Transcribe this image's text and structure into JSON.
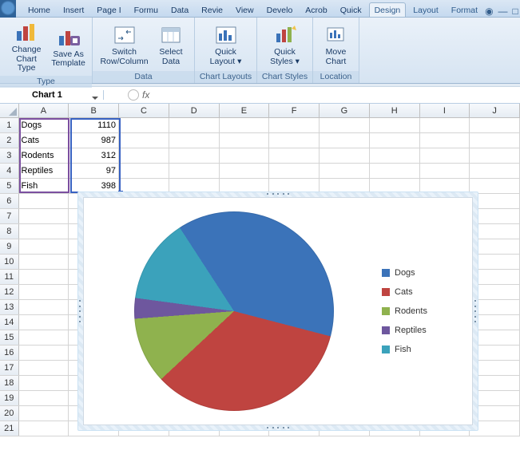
{
  "tabs": {
    "items": [
      "Home",
      "Insert",
      "Page I",
      "Formu",
      "Data",
      "Revie",
      "View",
      "Develo",
      "Acrob",
      "Quick",
      "Design",
      "Layout",
      "Format"
    ],
    "active": "Design"
  },
  "ribbon": {
    "type": {
      "label": "Type",
      "change_chart_type": "Change\nChart Type",
      "save_as_template": "Save As\nTemplate"
    },
    "data": {
      "label": "Data",
      "switch_row_col": "Switch\nRow/Column",
      "select_data": "Select\nData"
    },
    "chart_layouts": {
      "label": "Chart Layouts",
      "quick_layout": "Quick\nLayout ▾"
    },
    "chart_styles": {
      "label": "Chart Styles",
      "quick_styles": "Quick\nStyles ▾"
    },
    "location": {
      "label": "Location",
      "move_chart": "Move\nChart"
    }
  },
  "namebox": "Chart 1",
  "columns": [
    "A",
    "B",
    "C",
    "D",
    "E",
    "F",
    "G",
    "H",
    "I",
    "J"
  ],
  "row_head_count": 21,
  "cells": {
    "A1": "Dogs",
    "B1": "1110",
    "A2": "Cats",
    "B2": "987",
    "A3": "Rodents",
    "B3": "312",
    "A4": "Reptiles",
    "B4": "97",
    "A5": "Fish",
    "B5": "398"
  },
  "chart_data": {
    "type": "pie",
    "title": "",
    "categories": [
      "Dogs",
      "Cats",
      "Rodents",
      "Reptiles",
      "Fish"
    ],
    "values": [
      1110,
      987,
      312,
      97,
      398
    ],
    "colors": [
      "#3b73b9",
      "#bf4440",
      "#8fb24e",
      "#6e579e",
      "#3ba2bb"
    ],
    "legend_position": "right"
  }
}
